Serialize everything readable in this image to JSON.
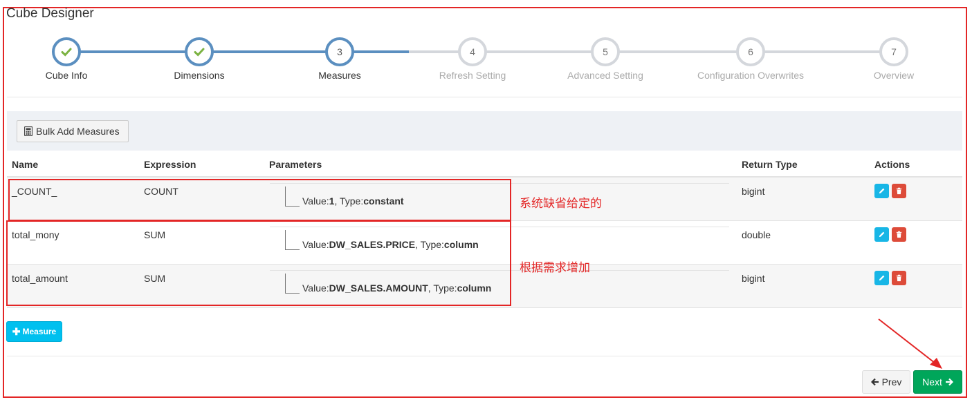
{
  "app": {
    "title": "Cube Designer"
  },
  "wizard": {
    "steps": [
      {
        "number": "1",
        "label": "Cube Info",
        "state": "done"
      },
      {
        "number": "2",
        "label": "Dimensions",
        "state": "done"
      },
      {
        "number": "3",
        "label": "Measures",
        "state": "current"
      },
      {
        "number": "4",
        "label": "Refresh Setting",
        "state": "todo"
      },
      {
        "number": "5",
        "label": "Advanced Setting",
        "state": "todo"
      },
      {
        "number": "6",
        "label": "Configuration Overwrites",
        "state": "todo"
      },
      {
        "number": "7",
        "label": "Overview",
        "state": "todo"
      }
    ]
  },
  "toolbar": {
    "bulk_add_label": "Bulk Add Measures"
  },
  "table": {
    "headers": {
      "name": "Name",
      "expression": "Expression",
      "parameters": "Parameters",
      "return_type": "Return Type",
      "actions": "Actions"
    },
    "rows": [
      {
        "name": "_COUNT_",
        "expression": "COUNT",
        "param_value": "1",
        "param_type": "constant",
        "return_type": "bigint"
      },
      {
        "name": "total_mony",
        "expression": "SUM",
        "param_value": "DW_SALES.PRICE",
        "param_type": "column",
        "return_type": "double"
      },
      {
        "name": "total_amount",
        "expression": "SUM",
        "param_value": "DW_SALES.AMOUNT",
        "param_type": "column",
        "return_type": "bigint"
      }
    ],
    "param_value_prefix": "Value:",
    "param_type_prefix": ", Type:"
  },
  "add_measure_label": "Measure",
  "nav": {
    "prev_label": "Prev",
    "next_label": "Next"
  },
  "annotations": {
    "default_note": "系统缺省给定的",
    "custom_note": "根据需求增加"
  },
  "colors": {
    "accent": "#5b8fc0",
    "annotation": "#e32626",
    "success": "#00a65a",
    "info": "#00c0ef",
    "danger": "#dd4b39"
  }
}
